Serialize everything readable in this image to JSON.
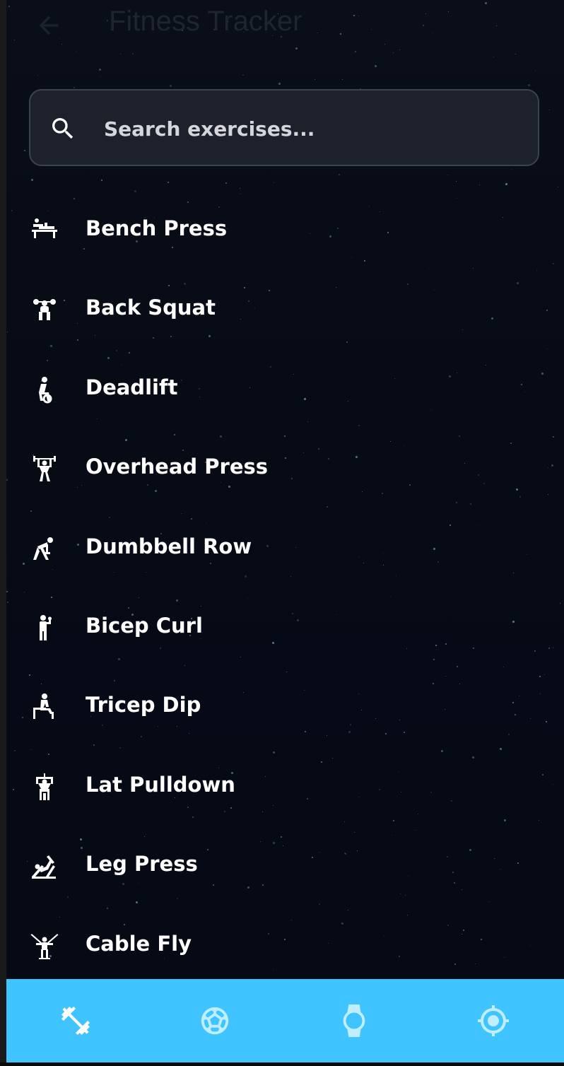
{
  "app_bar": {
    "back_icon": "arrow-back-icon",
    "title": "Fitness Tracker"
  },
  "search": {
    "icon": "search-icon",
    "placeholder": "Search exercises..."
  },
  "exercises": [
    {
      "label": "Bench Press",
      "icon": "bench-press-icon"
    },
    {
      "label": "Back Squat",
      "icon": "back-squat-icon"
    },
    {
      "label": "Deadlift",
      "icon": "deadlift-icon"
    },
    {
      "label": "Overhead Press",
      "icon": "overhead-press-icon"
    },
    {
      "label": "Dumbbell Row",
      "icon": "dumbbell-row-icon"
    },
    {
      "label": "Bicep Curl",
      "icon": "bicep-curl-icon"
    },
    {
      "label": "Tricep Dip",
      "icon": "tricep-dip-icon"
    },
    {
      "label": "Lat Pulldown",
      "icon": "lat-pulldown-icon"
    },
    {
      "label": "Leg Press",
      "icon": "leg-press-icon"
    },
    {
      "label": "Cable Fly",
      "icon": "cable-fly-icon"
    }
  ],
  "bottom_nav": {
    "items": [
      {
        "icon": "dumbbell-icon",
        "selected": true
      },
      {
        "icon": "soccer-ball-icon",
        "selected": false
      },
      {
        "icon": "smartwatch-icon",
        "selected": false
      },
      {
        "icon": "target-icon",
        "selected": false
      }
    ]
  },
  "colors": {
    "background": "#0b0f1a",
    "nav_background": "#40c4ff",
    "text": "#ffffff",
    "selected_icon": "#ffffff",
    "unselected_icon": "#bfeeff"
  }
}
